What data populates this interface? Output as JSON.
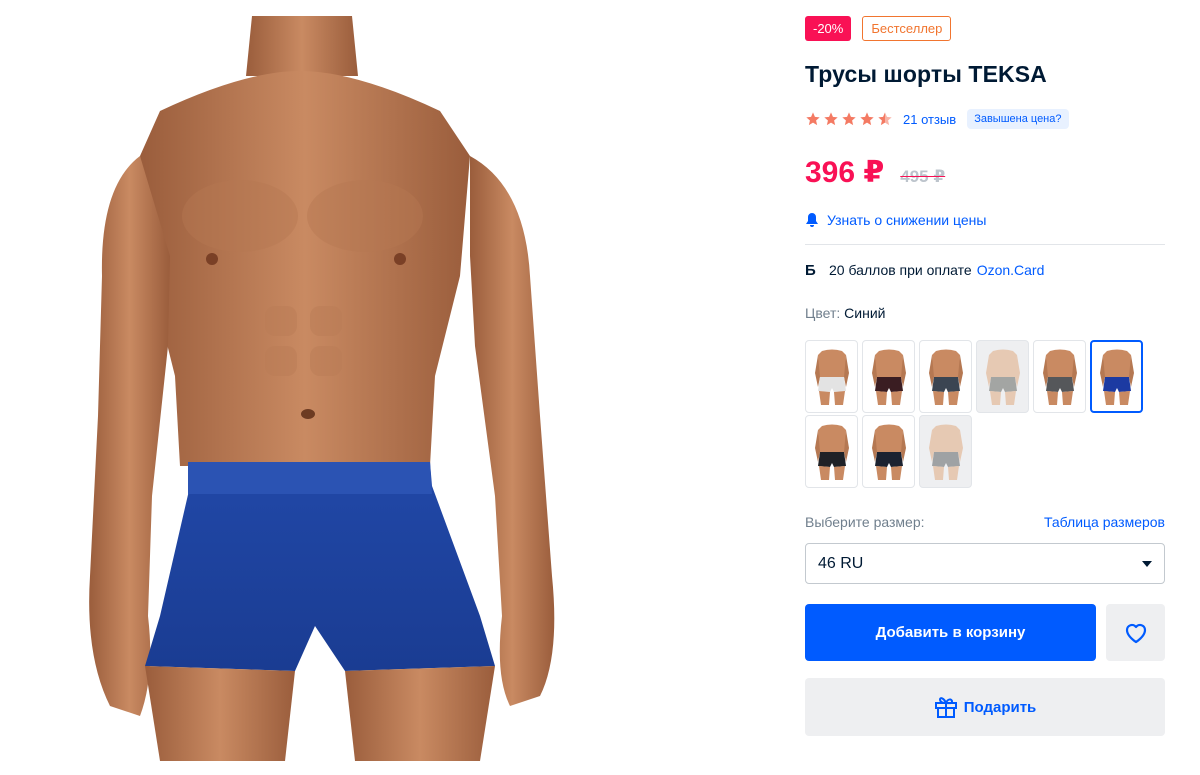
{
  "image": {
    "alt": "product-photo-blue-trunks"
  },
  "badges": {
    "discount": "-20%",
    "bestseller": "Бестселлер"
  },
  "product": {
    "title": "Трусы шорты TEKSA"
  },
  "rating": {
    "stars": 4.5,
    "reviews": "21 отзыв",
    "overprice": "Завышена цена?"
  },
  "price": {
    "current": "396 ₽",
    "old": "495 ₽"
  },
  "notify": {
    "label": "Узнать о снижении цены"
  },
  "bonus": {
    "icon": "Б",
    "text": "20 баллов при оплате",
    "link": "Ozon.Card"
  },
  "color": {
    "label": "Цвет:",
    "value": "Синий"
  },
  "swatches": [
    {
      "trunks": "#e3e3e3",
      "gray": false,
      "selected": false
    },
    {
      "trunks": "#3a1d22",
      "gray": false,
      "selected": false
    },
    {
      "trunks": "#3b4552",
      "gray": false,
      "selected": false
    },
    {
      "trunks": "#a3a5a3",
      "gray": true,
      "selected": false
    },
    {
      "trunks": "#55575a",
      "gray": false,
      "selected": false
    },
    {
      "trunks": "#1c3aa2",
      "gray": false,
      "selected": true
    },
    {
      "trunks": "#1f2126",
      "gray": false,
      "selected": false
    },
    {
      "trunks": "#1c2230",
      "gray": false,
      "selected": false
    },
    {
      "trunks": "#9fa2a4",
      "gray": true,
      "selected": false
    }
  ],
  "size": {
    "label": "Выберите размер:",
    "table_link": "Таблица размеров",
    "selected": "46 RU"
  },
  "buttons": {
    "add_to_cart": "Добавить в корзину",
    "gift": "Подарить"
  },
  "colors": {
    "accent": "#005bff",
    "sale": "#f91155",
    "bestseller": "#f1752f",
    "star": "#f47a63"
  }
}
